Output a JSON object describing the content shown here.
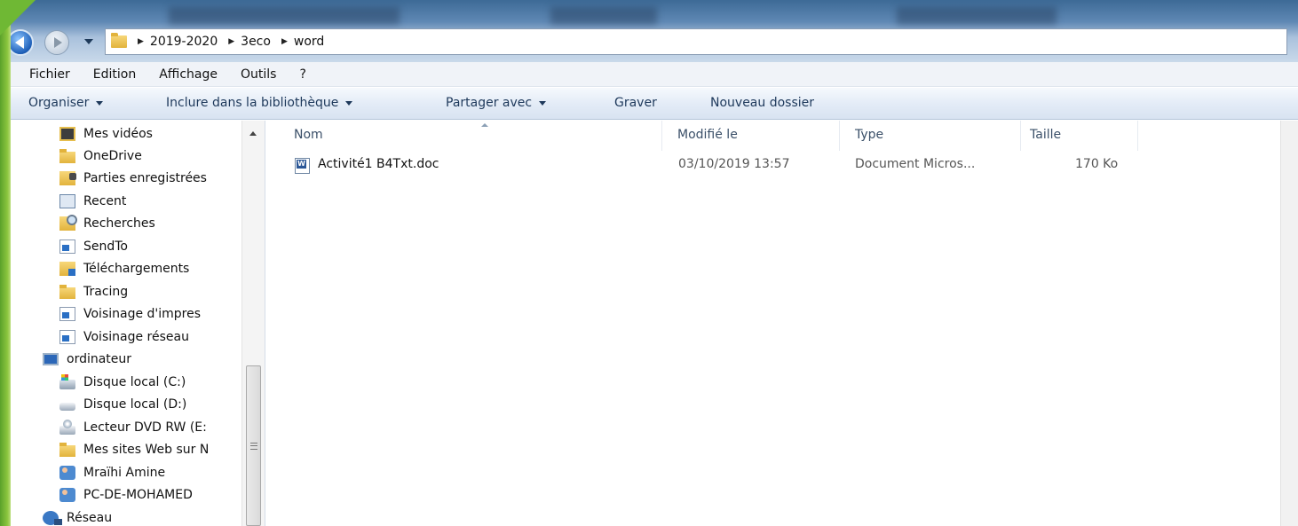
{
  "address": {
    "breadcrumbs": [
      "2019-2020",
      "3eco",
      "word"
    ]
  },
  "menu": {
    "items": [
      "Fichier",
      "Edition",
      "Affichage",
      "Outils",
      "?"
    ]
  },
  "toolbar": {
    "organize": "Organiser",
    "include_library": "Inclure dans la bibliothèque",
    "share_with": "Partager avec",
    "burn": "Graver",
    "new_folder": "Nouveau dossier"
  },
  "nav": {
    "items": [
      {
        "label": "Mes vidéos",
        "icon": "videos-folder-icon"
      },
      {
        "label": "OneDrive",
        "icon": "folder-icon"
      },
      {
        "label": "Parties enregistrées",
        "icon": "saved-games-folder-icon"
      },
      {
        "label": "Recent",
        "icon": "recent-icon"
      },
      {
        "label": "Recherches",
        "icon": "searches-folder-icon"
      },
      {
        "label": "SendTo",
        "icon": "shortcut-icon"
      },
      {
        "label": "Téléchargements",
        "icon": "downloads-folder-icon"
      },
      {
        "label": "Tracing",
        "icon": "folder-icon"
      },
      {
        "label": "Voisinage d'impres",
        "icon": "shortcut-icon"
      },
      {
        "label": "Voisinage réseau",
        "icon": "shortcut-icon"
      },
      {
        "label": "ordinateur",
        "icon": "computer-icon"
      },
      {
        "label": "Disque local (C:)",
        "icon": "system-drive-icon"
      },
      {
        "label": "Disque local (D:)",
        "icon": "drive-icon"
      },
      {
        "label": "Lecteur DVD RW (E:",
        "icon": "dvd-drive-icon"
      },
      {
        "label": "Mes sites Web sur N",
        "icon": "folder-icon"
      },
      {
        "label": "Mraïhi Amine",
        "icon": "user-icon"
      },
      {
        "label": "PC-DE-MOHAMED",
        "icon": "user-icon"
      },
      {
        "label": "Réseau",
        "icon": "network-icon"
      }
    ]
  },
  "filelist": {
    "columns": {
      "name": "Nom",
      "modified": "Modifié le",
      "type": "Type",
      "size": "Taille"
    },
    "rows": [
      {
        "name": "Activité1 B4Txt.doc",
        "modified": "03/10/2019 13:57",
        "type": "Document Micros...",
        "size": "170 Ko",
        "icon": "word-document-icon"
      }
    ]
  },
  "colors": {
    "accent_green": "#8cc63f",
    "command_bar_text": "#1e395b",
    "column_header_text": "#3a4f68"
  }
}
